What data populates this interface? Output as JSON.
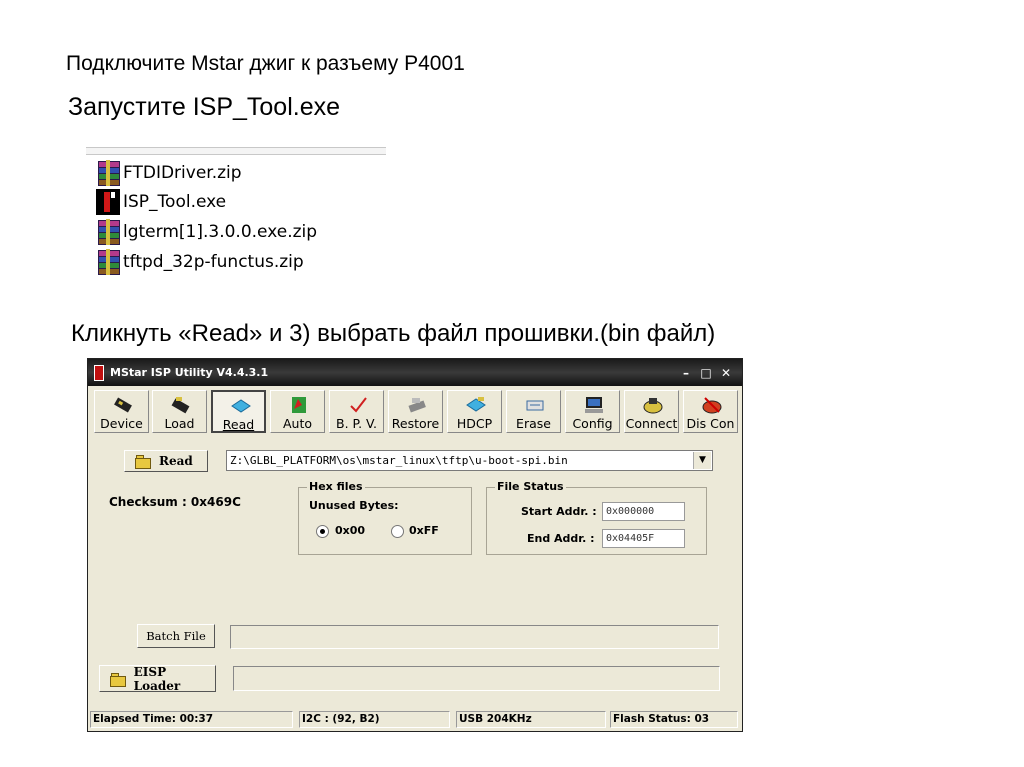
{
  "slide": {
    "title": "Подключите Mstar джиг к разъему P4001",
    "launch_text": "Запустите  ISP_Tool.exe",
    "instruction": "Кликнуть «Read» и 3) выбрать файл прошивки.(bin файл)"
  },
  "files": [
    {
      "name": "FTDIDriver.zip",
      "icon": "winrar-archive-icon"
    },
    {
      "name": "ISP_Tool.exe",
      "icon": "isp-tool-app-icon"
    },
    {
      "name": "lgterm[1].3.0.0.exe.zip",
      "icon": "winrar-archive-icon"
    },
    {
      "name": "tftpd_32p-functus.zip",
      "icon": "winrar-archive-icon"
    }
  ],
  "window": {
    "title": "MStar ISP Utility V4.4.3.1",
    "controls": {
      "minimize": "–",
      "maximize": "□",
      "close": "✕"
    }
  },
  "toolbar": [
    {
      "label": "Device",
      "icon": "chip-icon"
    },
    {
      "label": "Load",
      "icon": "chip-load-icon"
    },
    {
      "label": "Read",
      "icon": "chip-read-icon"
    },
    {
      "label": "Auto",
      "icon": "auto-icon"
    },
    {
      "label": "B. P. V.",
      "icon": "checkmark-icon"
    },
    {
      "label": "Restore",
      "icon": "restore-icon"
    },
    {
      "label": "HDCP",
      "icon": "hdcp-icon"
    },
    {
      "label": "Erase",
      "icon": "erase-icon"
    },
    {
      "label": "Config",
      "icon": "computer-icon"
    },
    {
      "label": "Connect",
      "icon": "connect-icon"
    },
    {
      "label": "Dis Con",
      "icon": "disconnect-icon"
    }
  ],
  "read_button": "Read",
  "file_path": "Z:\\GLBL_PLATFORM\\os\\mstar_linux\\tftp\\u-boot-spi.bin",
  "checksum": "Checksum : 0x469C",
  "hex_files": {
    "title": "Hex files",
    "unused_label": "Unused Bytes:",
    "options": [
      "0x00",
      "0xFF"
    ],
    "selected": "0x00"
  },
  "file_status": {
    "title": "File Status",
    "start_label": "Start Addr. :",
    "start_value": "0x000000",
    "end_label": "End Addr. :",
    "end_value": "0x04405F"
  },
  "batch_button": "Batch File",
  "eisp_button": "EISP Loader",
  "status": {
    "elapsed": "Elapsed Time: 00:37",
    "i2c": "I2C : (92, B2)",
    "usb": "USB  204KHz",
    "flash": "Flash Status: 03"
  }
}
